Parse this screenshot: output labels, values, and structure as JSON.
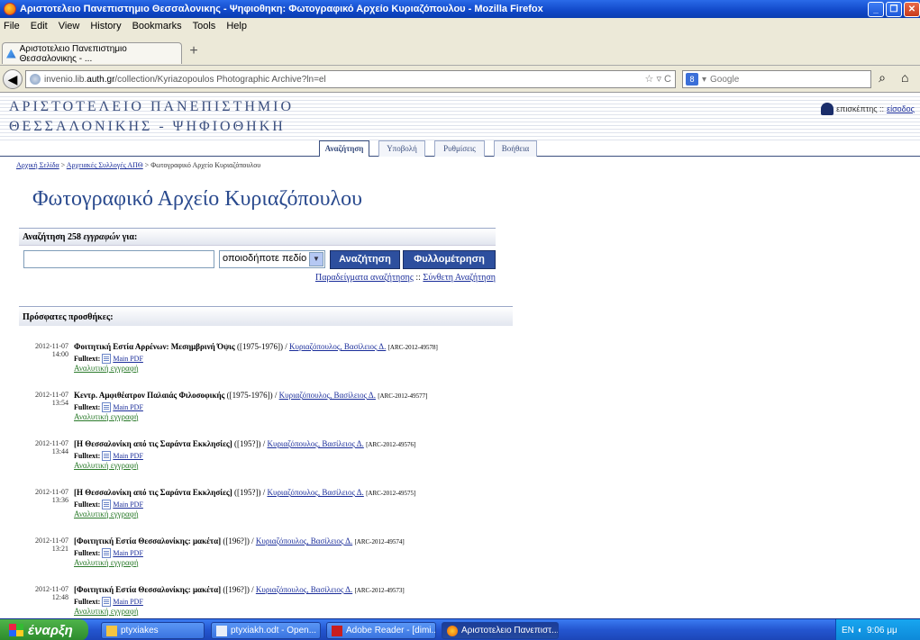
{
  "window": {
    "title": "Αριστοτελειο Πανεπιστημιο Θεσσαλονικης - Ψηφιοθηκη: Φωτογραφικό Αρχείο Κυριαζόπουλου - Mozilla Firefox"
  },
  "menu": [
    "File",
    "Edit",
    "View",
    "History",
    "Bookmarks",
    "Tools",
    "Help"
  ],
  "tab": {
    "label": "Αριστοτελειο Πανεπιστημιο Θεσσαλονικης - ..."
  },
  "nav": {
    "url_prefix": "invenio.lib.",
    "url_domain": "auth.gr",
    "url_rest": "/collection/Kyriazopoulos Photographic Archive?ln=el",
    "search_placeholder": "Google"
  },
  "site": {
    "logo_line1": "ΑΡΙΣΤΟΤΕΛΕΙΟ ΠΑΝΕΠΙΣΤΗΜΙΟ",
    "logo_line2": "ΘΕΣΣΑΛΟΝΙΚΗΣ - ΨΗΦΙΟΘΗΚΗ",
    "user_label": "επισκέπτης ::",
    "login_label": "είσοδος",
    "tabs": [
      "Αναζήτηση",
      "Υποβολή",
      "Ρυθμίσεις",
      "Βοήθεια"
    ]
  },
  "breadcrumb": {
    "home": "Αρχική Σελίδα",
    "sep": ">",
    "collections": "Αρχειακές Συλλογές ΑΠΘ",
    "current": "Φωτογραφικό Αρχείο Κυριαζόπουλου"
  },
  "collection_title": "Φωτογραφικό Αρχείο Κυριαζόπουλου",
  "search": {
    "header_prefix": "Αναζήτηση 258",
    "header_italic": "εγγραφών",
    "header_suffix": "για:",
    "input_value": "",
    "field_select": "οποιοδήποτε πεδίο",
    "search_button": "Αναζήτηση",
    "browse_button": "Φυλλομέτρηση",
    "examples_link": "Παραδείγματα αναζήτησης",
    "link_sep": "::",
    "advanced_link": "Σύνθετη Αναζήτηση"
  },
  "recent_header": "Πρόσφατες προσθήκες:",
  "records": [
    {
      "date": "2012-11-07",
      "time": "14:00",
      "title": "Φοιτητική Εστία Αρρένων: Μεσημβρινή Όψις",
      "year": "([1975-1976])",
      "author": "Κυριαζόπουλος, Βασίλειος Δ.",
      "id": "[ARC-2012-49578]"
    },
    {
      "date": "2012-11-07",
      "time": "13:54",
      "title": "Κεντρ. Αμφιθέατρον Παλαιάς Φιλοσοφικής",
      "year": "([1975-1976])",
      "author": "Κυριαζόπουλος, Βασίλειος Δ.",
      "id": "[ARC-2012-49577]"
    },
    {
      "date": "2012-11-07",
      "time": "13:44",
      "title": "[Η Θεσσαλονίκη από τις Σαράντα Εκκλησίες]",
      "year": "([195?])",
      "author": "Κυριαζόπουλος, Βασίλειος Δ.",
      "id": "[ARC-2012-49576]"
    },
    {
      "date": "2012-11-07",
      "time": "13:36",
      "title": "[Η Θεσσαλονίκη από τις Σαράντα Εκκλησίες]",
      "year": "([195?])",
      "author": "Κυριαζόπουλος, Βασίλειος Δ.",
      "id": "[ARC-2012-49575]"
    },
    {
      "date": "2012-11-07",
      "time": "13:21",
      "title": "[Φοιτητική Εστία Θεσσαλονίκης: μακέτα]",
      "year": "([196?])",
      "author": "Κυριαζόπουλος, Βασίλειος Δ.",
      "id": "[ARC-2012-49574]"
    },
    {
      "date": "2012-11-07",
      "time": "12:48",
      "title": "[Φοιτητική Εστία Θεσσαλονίκης: μακέτα]",
      "year": "([196?])",
      "author": "Κυριαζόπουλος, Βασίλειος Δ.",
      "id": "[ARC-2012-49573]"
    }
  ],
  "record_labels": {
    "fulltext": "Fulltext:",
    "main_pdf": "Main PDF",
    "detailed": "Αναλυτική εγγραφή"
  },
  "taskbar": {
    "start": "έναρξη",
    "tasks": [
      "ptyxiakes",
      "ptyxiakh.odt - Open...",
      "Adobe Reader - [dimi...",
      "Αριστοτελειο Πανεπιστ..."
    ],
    "lang": "EN",
    "clock": "9:06 μμ"
  },
  "colors": {
    "title_blue": "#2a4a8e",
    "link_blue": "#1a2d9a",
    "button_blue": "#2d4f9e",
    "detail_green": "#2a7a2a"
  }
}
